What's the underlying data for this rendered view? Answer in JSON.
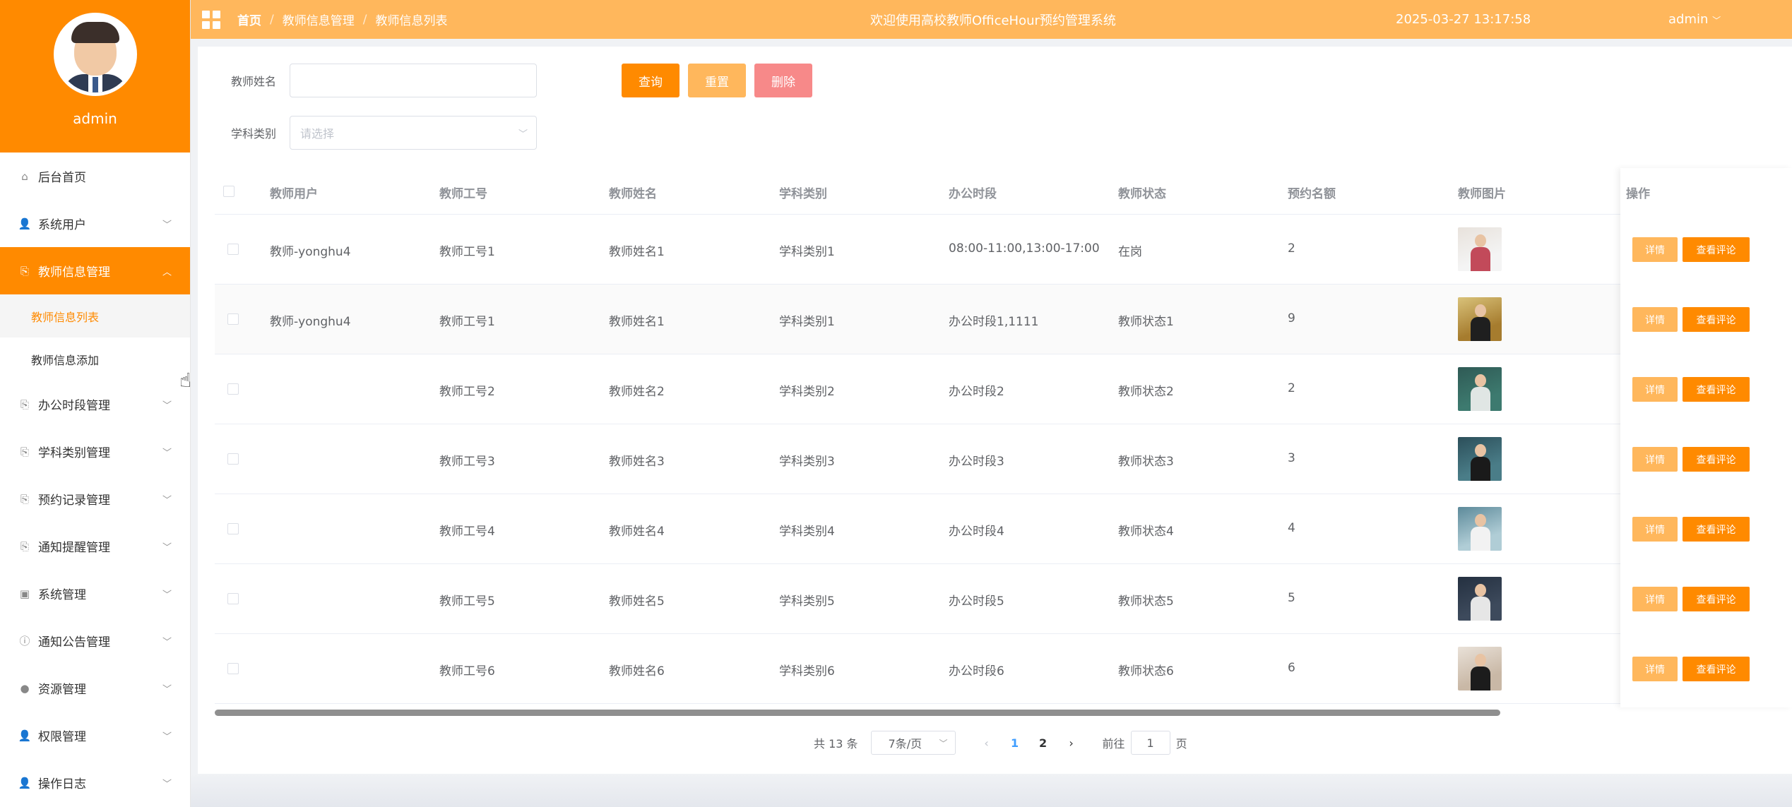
{
  "sidebar": {
    "username": "admin",
    "menu": [
      {
        "label": "后台首页",
        "icon": "home-icon",
        "expandable": false
      },
      {
        "label": "系统用户",
        "icon": "user-icon",
        "expandable": true
      },
      {
        "label": "教师信息管理",
        "icon": "document-icon",
        "expandable": true,
        "active": true
      },
      {
        "label": "办公时段管理",
        "icon": "document-icon",
        "expandable": true
      },
      {
        "label": "学科类别管理",
        "icon": "document-icon",
        "expandable": true
      },
      {
        "label": "预约记录管理",
        "icon": "document-icon",
        "expandable": true
      },
      {
        "label": "通知提醒管理",
        "icon": "document-icon",
        "expandable": true
      },
      {
        "label": "系统管理",
        "icon": "image-icon",
        "expandable": true
      },
      {
        "label": "通知公告管理",
        "icon": "info-circle-icon",
        "expandable": true
      },
      {
        "label": "资源管理",
        "icon": "location-icon",
        "expandable": true
      },
      {
        "label": "权限管理",
        "icon": "user-icon",
        "expandable": true
      },
      {
        "label": "操作日志",
        "icon": "user-icon",
        "expandable": true
      }
    ],
    "submenu": [
      {
        "label": "教师信息列表",
        "active": true
      },
      {
        "label": "教师信息添加",
        "active": false
      }
    ]
  },
  "header": {
    "breadcrumb": [
      "首页",
      "教师信息管理",
      "教师信息列表"
    ],
    "title": "欢迎使用高校教师OfficeHour预约管理系统",
    "datetime": "2025-03-27 13:17:58",
    "user": "admin"
  },
  "search": {
    "name_label": "教师姓名",
    "name_value": "",
    "category_label": "学科类别",
    "category_placeholder": "请选择",
    "query_button": "查询",
    "reset_button": "重置",
    "delete_button": "删除"
  },
  "table": {
    "columns": [
      "教师用户",
      "教师工号",
      "教师姓名",
      "学科类别",
      "办公时段",
      "教师状态",
      "预约名额",
      "教师图片",
      "操作"
    ],
    "detail_button": "详情",
    "review_button": "查看评论",
    "rows": [
      {
        "user": "教师-yonghu4",
        "id": "教师工号1",
        "name": "教师姓名1",
        "category": "学科类别1",
        "hours": "08:00-11:00,13:00-17:00",
        "status": "在岗",
        "quota": "2"
      },
      {
        "user": "教师-yonghu4",
        "id": "教师工号1",
        "name": "教师姓名1",
        "category": "学科类别1",
        "hours": "办公时段1,1111",
        "status": "教师状态1",
        "quota": "9"
      },
      {
        "user": "",
        "id": "教师工号2",
        "name": "教师姓名2",
        "category": "学科类别2",
        "hours": "办公时段2",
        "status": "教师状态2",
        "quota": "2"
      },
      {
        "user": "",
        "id": "教师工号3",
        "name": "教师姓名3",
        "category": "学科类别3",
        "hours": "办公时段3",
        "status": "教师状态3",
        "quota": "3"
      },
      {
        "user": "",
        "id": "教师工号4",
        "name": "教师姓名4",
        "category": "学科类别4",
        "hours": "办公时段4",
        "status": "教师状态4",
        "quota": "4"
      },
      {
        "user": "",
        "id": "教师工号5",
        "name": "教师姓名5",
        "category": "学科类别5",
        "hours": "办公时段5",
        "status": "教师状态5",
        "quota": "5"
      },
      {
        "user": "",
        "id": "教师工号6",
        "name": "教师姓名6",
        "category": "学科类别6",
        "hours": "办公时段6",
        "status": "教师状态6",
        "quota": "6"
      }
    ]
  },
  "pagination": {
    "total": "共 13 条",
    "page_size": "7条/页",
    "pages": [
      "1",
      "2"
    ],
    "current": "1",
    "goto_label": "前往",
    "goto_value": "1",
    "goto_suffix": "页"
  },
  "colors": {
    "accent": "#ff8a00",
    "header": "#ffb75c",
    "delete": "#f78989"
  }
}
